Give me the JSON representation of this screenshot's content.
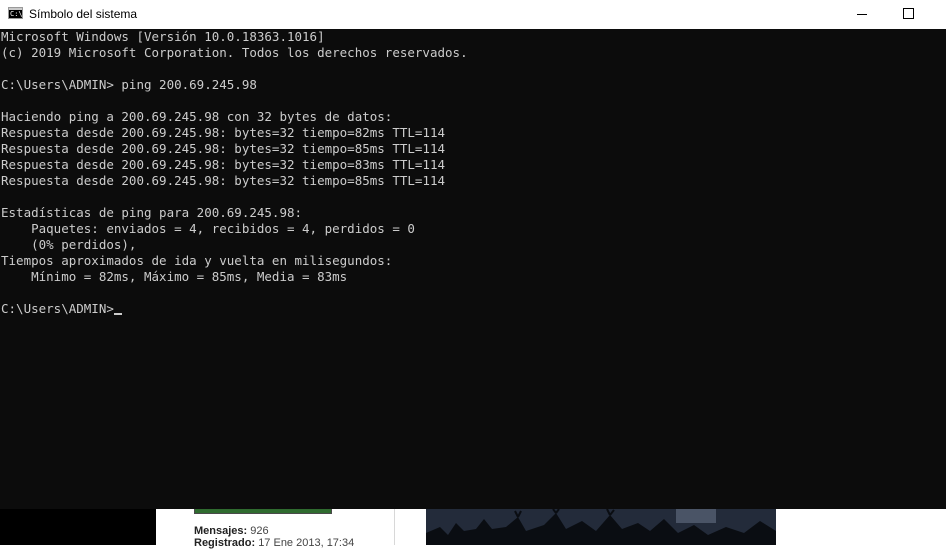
{
  "window": {
    "title": "Símbolo del sistema",
    "icon": "cmd-icon",
    "controls": [
      "minimize-icon",
      "maximize-icon"
    ]
  },
  "console": {
    "lines": [
      "Microsoft Windows [Versión 10.0.18363.1016]",
      "(c) 2019 Microsoft Corporation. Todos los derechos reservados.",
      "",
      "C:\\Users\\ADMIN> ping 200.69.245.98",
      "",
      "Haciendo ping a 200.69.245.98 con 32 bytes de datos:",
      "Respuesta desde 200.69.245.98: bytes=32 tiempo=82ms TTL=114",
      "Respuesta desde 200.69.245.98: bytes=32 tiempo=85ms TTL=114",
      "Respuesta desde 200.69.245.98: bytes=32 tiempo=83ms TTL=114",
      "Respuesta desde 200.69.245.98: bytes=32 tiempo=85ms TTL=114",
      "",
      "Estadísticas de ping para 200.69.245.98:",
      "    Paquetes: enviados = 4, recibidos = 4, perdidos = 0",
      "    (0% perdidos),",
      "Tiempos aproximados de ida y vuelta en milisegundos:",
      "    Mínimo = 82ms, Máximo = 85ms, Media = 83ms",
      ""
    ],
    "prompt": "C:\\Users\\ADMIN>",
    "colors": {
      "background": "#0c0c0c",
      "text": "#cccccc"
    }
  },
  "background_page": {
    "post_info": {
      "messages_label": "Mensajes:",
      "messages_value": "926",
      "registered_label": "Registrado:",
      "registered_value": "17 Ene 2013, 17:34"
    }
  }
}
